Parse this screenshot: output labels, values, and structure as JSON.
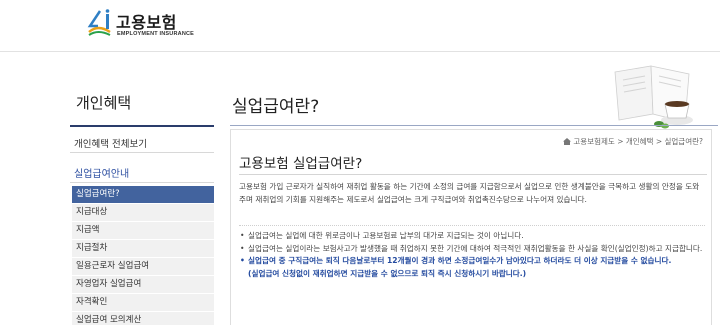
{
  "logo": {
    "korean": "고용보험",
    "english": "EMPLOYMENT INSURANCE",
    "brand_color": "#1a1a1a",
    "accent": "#2f7fc4"
  },
  "sidebar": {
    "title": "개인혜택",
    "all_link": "개인혜택 전체보기",
    "section": "실업급여안내",
    "items": [
      {
        "label": "실업급여란?"
      },
      {
        "label": "지급대상"
      },
      {
        "label": "지급액"
      },
      {
        "label": "지급절차"
      },
      {
        "label": "일용근로자 실업급여"
      },
      {
        "label": "자영업자 실업급여"
      },
      {
        "label": "자격확인"
      },
      {
        "label": "실업급여 모의계산"
      }
    ],
    "active_color": "#42639e"
  },
  "main": {
    "title": "실업급여란?",
    "breadcrumb": "고용보험제도 > 개인혜택 > 실업급여란?",
    "content_title": "고용보험 실업급여란?",
    "intro": "고용보험 가입 근로자가 실직하여 재취업 활동을 하는 기간에 소정의 급여를 지급함으로서 실업으로 인한 생계불안을 극복하고 생활의 안정을 도와주며 재취업의 기회를 지원해주는 제도로서 실업급여는 크게 구직급여와 취업촉진수당으로 나누어져 있습니다.",
    "bullets": [
      "실업급여는 실업에 대한 위로금이나 고용보험료 납부의 대가로 지급되는 것이 아닙니다.",
      "실업급여는 실업이라는 보험사고가 발생했을 때 취업하지 못한 기간에 대하여 적극적인 재취업활동을 한 사실을 확인(실업인정)하고 지급합니다."
    ],
    "highlight": "실업급여 중 구직급여는 퇴직 다음날로부터 12개월이 경과 하면 소정급여일수가 남아있다고 하더라도 더 이상 지급받을 수 없습니다.",
    "note": "(실업급여 신청없이 재취업하면 지급받을 수 없으므로 퇴직 즉시 신청하시기 바랍니다.)"
  }
}
